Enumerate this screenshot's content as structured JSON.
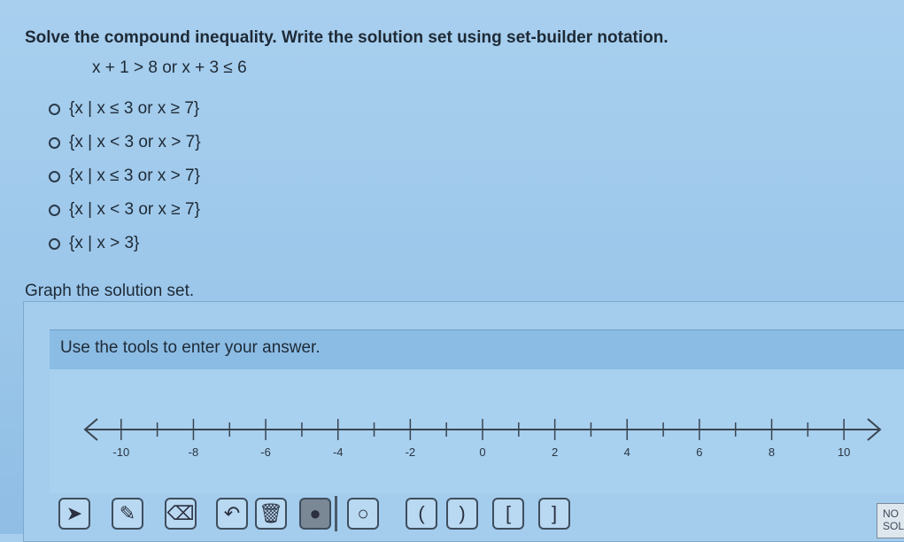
{
  "question": {
    "prompt": "Solve the compound inequality. Write the solution set using set-builder notation.",
    "equation": "x + 1 > 8 or x + 3 ≤ 6"
  },
  "choices": [
    {
      "text": "{x | x ≤ 3 or x ≥ 7}"
    },
    {
      "text": "{x | x < 3 or x > 7}"
    },
    {
      "text": "{x | x ≤ 3 or x > 7}"
    },
    {
      "text": "{x | x < 3 or x ≥ 7}"
    },
    {
      "text": "{x | x > 3}"
    }
  ],
  "graph": {
    "label": "Graph the solution set.",
    "banner": "Use the tools to enter your answer."
  },
  "number_line": {
    "min": -11,
    "max": 11,
    "labels": [
      "-10",
      "-8",
      "-6",
      "-4",
      "-2",
      "0",
      "2",
      "4",
      "6",
      "8",
      "10"
    ]
  },
  "toolbar": {
    "tools": [
      {
        "name": "pointer-tool",
        "glyph": "➤"
      },
      {
        "name": "pencil-tool",
        "glyph": "✎"
      },
      {
        "name": "eraser-tool",
        "glyph": "⌫"
      },
      {
        "name": "undo-tool",
        "glyph": "↶"
      },
      {
        "name": "trash-tool",
        "glyph": "🗑"
      },
      {
        "name": "closed-dot-tool",
        "glyph": "●"
      },
      {
        "name": "open-dot-tool",
        "glyph": "○"
      },
      {
        "name": "left-paren-tool",
        "glyph": "("
      },
      {
        "name": "right-paren-tool",
        "glyph": ")"
      },
      {
        "name": "left-bracket-tool",
        "glyph": "["
      },
      {
        "name": "right-bracket-tool",
        "glyph": "]"
      }
    ],
    "no_solution": "NO SOL"
  }
}
